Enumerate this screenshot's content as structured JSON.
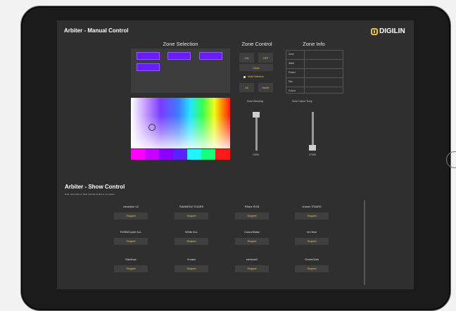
{
  "header": {
    "title": "Arbiter - Manual Control",
    "brand": "DIGILIN"
  },
  "zone_selection": {
    "title": "Zone Selection",
    "zones": [
      {
        "label": "",
        "color": "#6a1cff"
      },
      {
        "label": "",
        "color": "#6a1cff"
      },
      {
        "label": "",
        "color": "#6a1cff"
      },
      {
        "label": "",
        "color": "#6a1cff"
      }
    ]
  },
  "zone_control": {
    "title": "Zone Control",
    "on_label": "ON",
    "off_label": "OFF",
    "clear_label": "Clear",
    "multi_selection_label": "Multi Selection",
    "all_label": "All",
    "none_label": "None",
    "dimming_label": "Zone Dimming",
    "dimming_value": "100%",
    "colour_temp_label": "Zone Colour Temp",
    "colour_temp_value": "2700K"
  },
  "zone_info": {
    "title": "Zone Info",
    "rows": [
      "Zone",
      "State",
      "Power",
      "Dim",
      "Colour"
    ]
  },
  "swatches": [
    "#ff00ff",
    "#c800ff",
    "#8a00ff",
    "#5a22ff",
    "#22f5ff",
    "#17ff7a",
    "#ff1a1a"
  ],
  "show_control": {
    "title": "Arbiter - Show Control",
    "note": "Note: remember to clear manual control to run shows",
    "items": [
      {
        "name": "circadian V2",
        "status": "Stopped"
      },
      {
        "name": "RAINBOW STAIRS",
        "status": "Stopped"
      },
      {
        "name": "Pillars RGB",
        "status": "Stopped"
      },
      {
        "name": "chaser STAIRS",
        "status": "Stopped"
      },
      {
        "name": "RGBWCycle ALL",
        "status": "Stopped"
      },
      {
        "name": "White ALL",
        "status": "Stopped"
      },
      {
        "name": "ColourStatic",
        "status": "Stopped"
      },
      {
        "name": "red blue",
        "status": "Stopped"
      },
      {
        "name": "Rainbow",
        "status": "Stopped"
      },
      {
        "name": "Xmass",
        "status": "Stopped"
      },
      {
        "name": "rainbow2",
        "status": "Stopped"
      },
      {
        "name": "GreenGold",
        "status": "Stopped"
      }
    ]
  }
}
